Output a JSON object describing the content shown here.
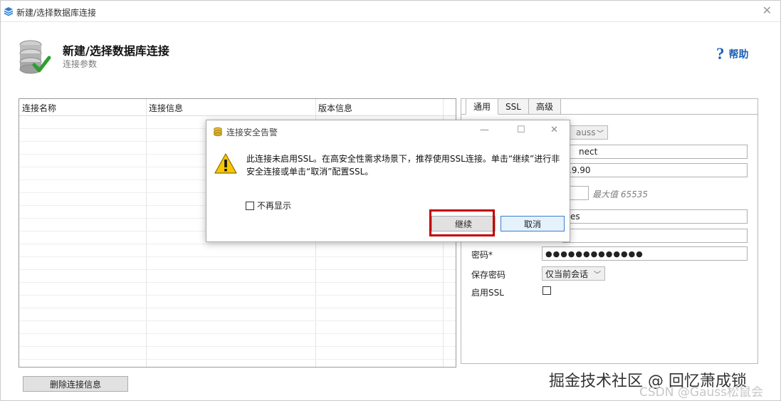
{
  "window": {
    "title": "新建/选择数据库连接",
    "close_glyph": "✕"
  },
  "header": {
    "title": "新建/选择数据库连接",
    "subtitle": "连接参数",
    "help_label": "帮助"
  },
  "connection_table": {
    "columns": [
      "连接名称",
      "连接信息",
      "版本信息"
    ],
    "rows": []
  },
  "delete_button_label": "删除连接信息",
  "tabs": [
    {
      "label": "通用",
      "active": true
    },
    {
      "label": "SSL",
      "active": false
    },
    {
      "label": "高级",
      "active": false
    }
  ],
  "form": {
    "db_type_partial": "auss",
    "connection_name_partial": "nect",
    "host_partial": ".9.90",
    "port_value": "",
    "port_hint": "最大值 65535",
    "database_partial": "es",
    "password_label": "密码*",
    "password_value": "●●●●●●●●●●●●●",
    "save_password_label": "保存密码",
    "save_password_value": "仅当前会话",
    "enable_ssl_label": "启用SSL",
    "enable_ssl_checked": false
  },
  "dialog": {
    "title": "连接安全告警",
    "message": "此连接未启用SSL。在高安全性需求场景下，推荐使用SSL连接。单击“继续”进行非安全连接或单击“取消”配置SSL。",
    "dont_show_label": "不再显示",
    "continue_label": "继续",
    "cancel_label": "取消",
    "minimize_glyph": "—",
    "maximize_glyph": "☐",
    "close_glyph": "✕"
  },
  "watermark": {
    "line1": "掘金技术社区 @ 回忆萧成锁",
    "line2": "CSDN @Gauss松鼠会"
  },
  "colors": {
    "accent_blue": "#1c5fb8",
    "highlight_red": "#c00000",
    "default_button_border": "#3b7ed6"
  },
  "icons": [
    "database-stack-icon",
    "database-check-icon",
    "help-question-icon",
    "db-coin-icon",
    "warning-icon"
  ]
}
